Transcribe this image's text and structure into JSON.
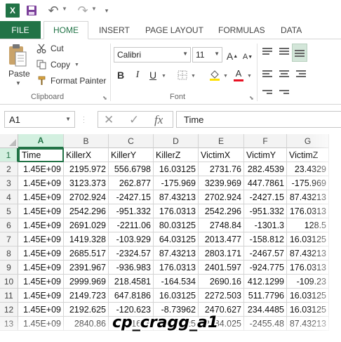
{
  "app": {
    "logo_letter": "X",
    "accent_color": "#217346"
  },
  "quick_access": {
    "icons": [
      "excel-logo-icon",
      "save-icon",
      "undo-icon",
      "redo-icon",
      "customize-qat-icon"
    ]
  },
  "ribbon_tabs": {
    "file": "FILE",
    "home": "HOME",
    "insert": "INSERT",
    "page_layout": "PAGE LAYOUT",
    "formulas": "FORMULAS",
    "data": "DATA"
  },
  "clipboard": {
    "paste": "Paste",
    "cut": "Cut",
    "copy": "Copy",
    "format_painter": "Format Painter",
    "group_label": "Clipboard"
  },
  "font": {
    "family": "Calibri",
    "size": "11",
    "bold": "B",
    "italic": "I",
    "underline": "U",
    "group_label": "Font",
    "font_color": "#e81123",
    "fill_color": "#ffe000"
  },
  "formula_bar": {
    "name_box": "A1",
    "fx": "fx",
    "value": "Time"
  },
  "sheet": {
    "columns": [
      "A",
      "B",
      "C",
      "D",
      "E",
      "F",
      "G"
    ],
    "rows": [
      {
        "num": "1",
        "cells": [
          "Time",
          "KillerX",
          "KillerY",
          "KillerZ",
          "VictimX",
          "VictimY",
          "VictimZ"
        ]
      },
      {
        "num": "2",
        "cells": [
          "1.45E+09",
          "2195.972",
          "556.6798",
          "16.03125",
          "2731.76",
          "282.4539",
          "23.4329"
        ]
      },
      {
        "num": "3",
        "cells": [
          "1.45E+09",
          "3123.373",
          "262.877",
          "-175.969",
          "3239.969",
          "447.7861",
          "-175.969"
        ]
      },
      {
        "num": "4",
        "cells": [
          "1.45E+09",
          "2702.924",
          "-2427.15",
          "87.43213",
          "2702.924",
          "-2427.15",
          "87.43213"
        ]
      },
      {
        "num": "5",
        "cells": [
          "1.45E+09",
          "2542.296",
          "-951.332",
          "176.0313",
          "2542.296",
          "-951.332",
          "176.0313"
        ]
      },
      {
        "num": "6",
        "cells": [
          "1.45E+09",
          "2691.029",
          "-2211.06",
          "80.03125",
          "2748.84",
          "-1301.3",
          "128.5"
        ]
      },
      {
        "num": "7",
        "cells": [
          "1.45E+09",
          "1419.328",
          "-103.929",
          "64.03125",
          "2013.477",
          "-158.812",
          "16.03125"
        ]
      },
      {
        "num": "8",
        "cells": [
          "1.45E+09",
          "2685.517",
          "-2324.57",
          "87.43213",
          "2803.171",
          "-2467.57",
          "87.43213"
        ]
      },
      {
        "num": "9",
        "cells": [
          "1.45E+09",
          "2391.967",
          "-936.983",
          "176.0313",
          "2401.597",
          "-924.775",
          "176.0313"
        ]
      },
      {
        "num": "10",
        "cells": [
          "1.45E+09",
          "2999.969",
          "218.4581",
          "-164.534",
          "2690.16",
          "412.1299",
          "-109.23"
        ]
      },
      {
        "num": "11",
        "cells": [
          "1.45E+09",
          "2149.723",
          "647.8186",
          "16.03125",
          "2272.503",
          "511.7796",
          "16.03125"
        ]
      },
      {
        "num": "12",
        "cells": [
          "1.45E+09",
          "2192.625",
          "-120.623",
          "-8.73962",
          "2470.627",
          "234.4485",
          "16.03125"
        ]
      },
      {
        "num": "13",
        "cells": [
          "1.45E+09",
          "2840.86",
          "-1698",
          "16.03125",
          "2684.025",
          "-2455.48",
          "87.43213"
        ]
      }
    ]
  },
  "watermark": "cp_cragg_a1"
}
